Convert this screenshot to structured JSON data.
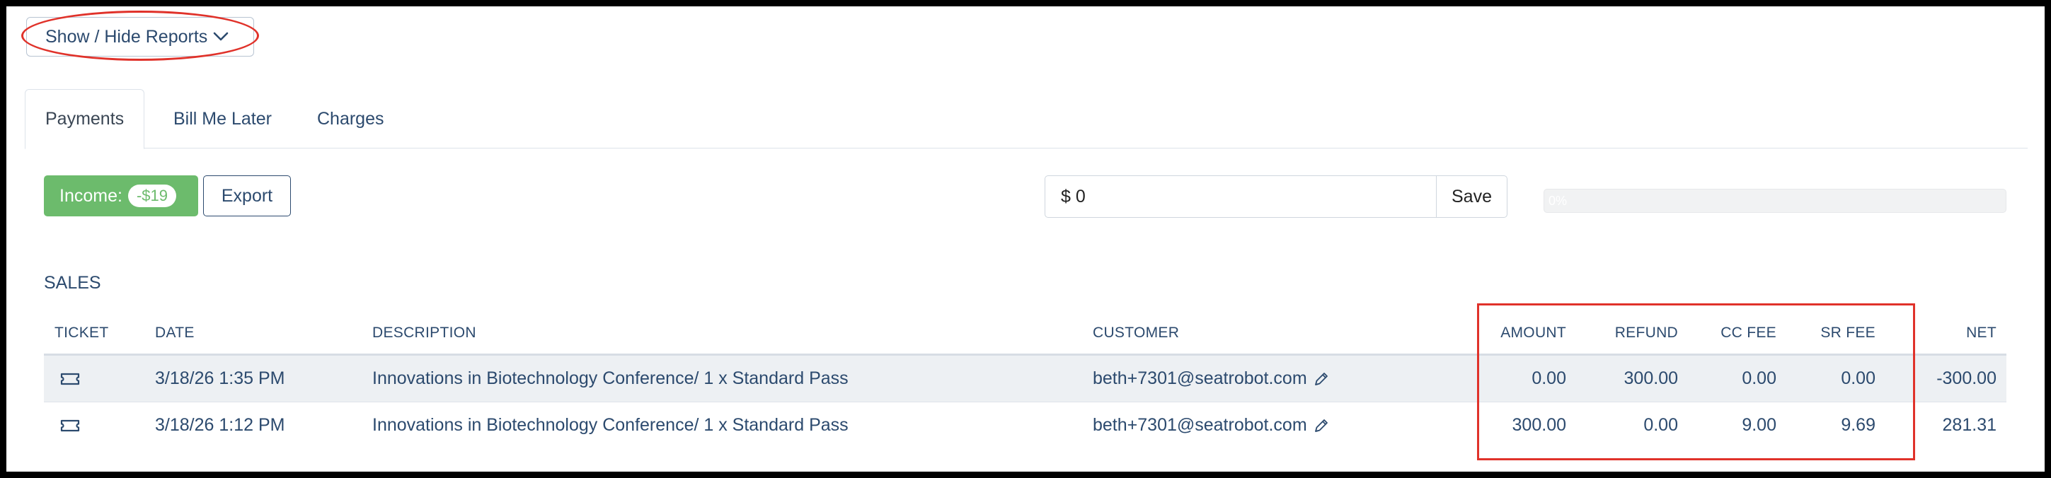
{
  "reports_toggle": {
    "label": "Show / Hide Reports",
    "icon": "chevron-down-icon"
  },
  "tabs": [
    {
      "label": "Payments",
      "active": true
    },
    {
      "label": "Bill Me Later",
      "active": false
    },
    {
      "label": "Charges",
      "active": false
    }
  ],
  "toolbar": {
    "income_label": "Income:",
    "income_badge": "-$19",
    "export_label": "Export",
    "amount_value": "$ 0",
    "save_label": "Save",
    "progress_label": "0%",
    "progress_fraction": 0
  },
  "sales": {
    "title": "SALES",
    "columns": {
      "ticket": "TICKET",
      "date": "DATE",
      "description": "DESCRIPTION",
      "customer": "CUSTOMER",
      "amount": "AMOUNT",
      "refund": "REFUND",
      "cc_fee": "CC FEE",
      "sr_fee": "SR FEE",
      "net": "NET"
    },
    "rows": [
      {
        "date": "3/18/26 1:35 PM",
        "description": "Innovations in Biotechnology Conference/ 1 x Standard Pass",
        "customer": "beth+7301@seatrobot.com",
        "amount": "0.00",
        "refund": "300.00",
        "cc_fee": "0.00",
        "sr_fee": "0.00",
        "net": "-300.00"
      },
      {
        "date": "3/18/26 1:12 PM",
        "description": "Innovations in Biotechnology Conference/ 1 x Standard Pass",
        "customer": "beth+7301@seatrobot.com",
        "amount": "300.00",
        "refund": "0.00",
        "cc_fee": "9.00",
        "sr_fee": "9.69",
        "net": "281.31"
      }
    ]
  },
  "colors": {
    "text": "#2c4a6e",
    "income_green": "#6cbb6c",
    "annotation_red": "#e0322a",
    "row_stripe": "#edf0f3"
  }
}
